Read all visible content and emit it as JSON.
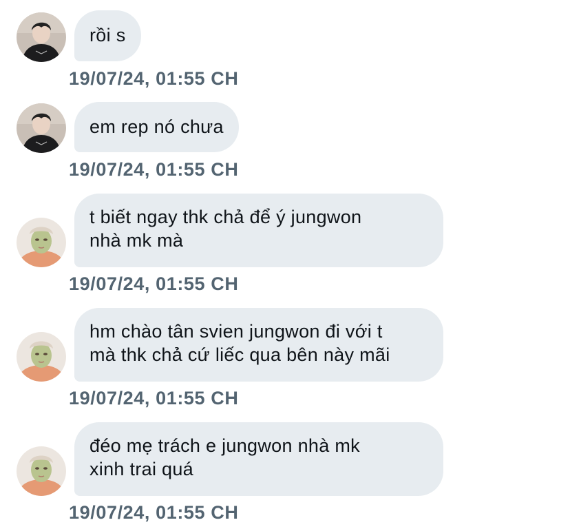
{
  "messages": [
    {
      "sender": "user-a",
      "text": "rồi s",
      "timestamp": "19/07/24, 01:55 CH"
    },
    {
      "sender": "user-a",
      "text": "em rep nó chưa",
      "timestamp": "19/07/24, 01:55 CH"
    },
    {
      "sender": "user-b",
      "text": "t biết ngay thk chả để ý jungwon\nnhà mk mà",
      "timestamp": "19/07/24, 01:55 CH"
    },
    {
      "sender": "user-b",
      "text": "hm chào tân svien jungwon đi với t\nmà thk chả cứ liếc qua bên này mãi",
      "timestamp": "19/07/24, 01:55 CH"
    },
    {
      "sender": "user-b",
      "text": "đéo mẹ trách e jungwon nhà mk\nxinh trai quá",
      "timestamp": "19/07/24, 01:55 CH"
    }
  ],
  "colors": {
    "bubble_bg": "#e7ecf0",
    "text": "#0f1419",
    "timestamp": "#536471"
  }
}
